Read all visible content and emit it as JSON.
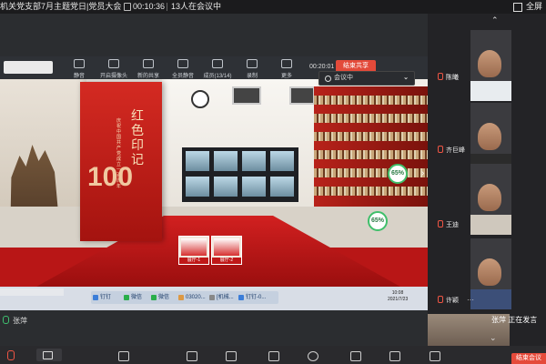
{
  "topbar": {
    "meeting_title": "机关党支部7月主题党日|党员大会",
    "timer": "00:10:36",
    "participants": "13人在会议中",
    "fullscreen_label": "全屏"
  },
  "share_toolbar": {
    "buttons": [
      {
        "label": "静音",
        "icon": "mic-icon"
      },
      {
        "label": "开启摄像头",
        "icon": "camera-icon"
      },
      {
        "label": "新的共享",
        "icon": "share-icon"
      },
      {
        "label": "全员静音",
        "icon": "mute-all-icon"
      },
      {
        "label": "成员(13/14)",
        "icon": "members-icon"
      },
      {
        "label": "录制",
        "icon": "record-icon"
      },
      {
        "label": "更多",
        "icon": "more-icon"
      }
    ],
    "share_timer": "00:20:01",
    "end_share_label": "结束共享",
    "meeting_status": "会议中"
  },
  "slide": {
    "banner_title": "红色印记",
    "banner_sub": "庆祝中国共产党成立一百周年",
    "banner_number": "100",
    "badge_percent_a": "65%",
    "badge_percent_b": "65%",
    "thumb_1": "展厅-1",
    "thumb_2": "展厅-2"
  },
  "taskbar": {
    "apps": [
      "钉钉",
      "微信",
      "微信",
      "03020...",
      "[机械...",
      "钉钉-0..."
    ],
    "time": "10:08",
    "date": "2021/7/23"
  },
  "local_user": "张萍",
  "participants": [
    {
      "name": "陈曦"
    },
    {
      "name": "齐巨峰"
    },
    {
      "name": "王迪"
    },
    {
      "name": "许颖"
    }
  ],
  "active_speaker": {
    "name": "张萍",
    "status": "正在发言"
  },
  "bottombar": {
    "end_meeting_label": "结束会议"
  }
}
